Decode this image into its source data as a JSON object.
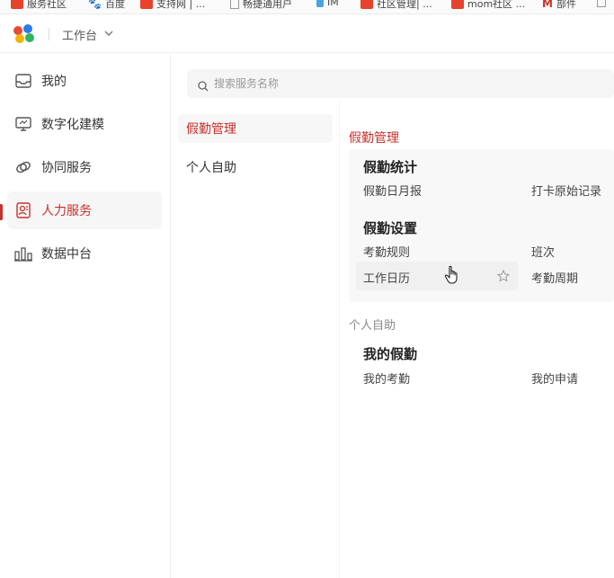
{
  "bookmarks": [
    {
      "label": "服务社区",
      "color": "#e8412c"
    },
    {
      "label": "百度",
      "color": "#2f6bd8"
    },
    {
      "label": "支持网 | ...",
      "color": "#e8412c"
    },
    {
      "label": "畅捷通用户",
      "color": "#cccccc"
    },
    {
      "label": "IM",
      "color": "#4aa3df"
    },
    {
      "label": "社区管理| ...",
      "color": "#e8412c"
    },
    {
      "label": "mom社区 ...",
      "color": "#e8412c"
    },
    {
      "label": "部件",
      "color": "#c8302a"
    }
  ],
  "header": {
    "workspace": "工作台"
  },
  "nav": {
    "items": [
      {
        "label": "我的",
        "icon": "inbox-icon"
      },
      {
        "label": "数字化建模",
        "icon": "monitor-icon"
      },
      {
        "label": "协同服务",
        "icon": "link-icon"
      },
      {
        "label": "人力服务",
        "icon": "person-card-icon"
      },
      {
        "label": "数据中台",
        "icon": "bar-chart-icon"
      }
    ],
    "active_index": 3
  },
  "search": {
    "placeholder": "搜索服务名称"
  },
  "categories": [
    {
      "label": "假勤管理",
      "active": true
    },
    {
      "label": "个人自助",
      "active": false
    }
  ],
  "sections": {
    "attendance": {
      "title": "假勤管理",
      "groups": {
        "stats": {
          "title": "假勤统计",
          "items": [
            "假勤日月报",
            "打卡原始记录"
          ]
        },
        "settings": {
          "title": "假勤设置",
          "items": [
            "考勤规则",
            "班次",
            "工作日历",
            "考勤周期"
          ]
        }
      }
    },
    "self_service": {
      "title": "个人自助",
      "groups": {
        "my_leave": {
          "title": "我的假勤",
          "items": [
            "我的考勤",
            "我的申请"
          ]
        }
      }
    }
  },
  "colors": {
    "accent": "#c8302a"
  }
}
